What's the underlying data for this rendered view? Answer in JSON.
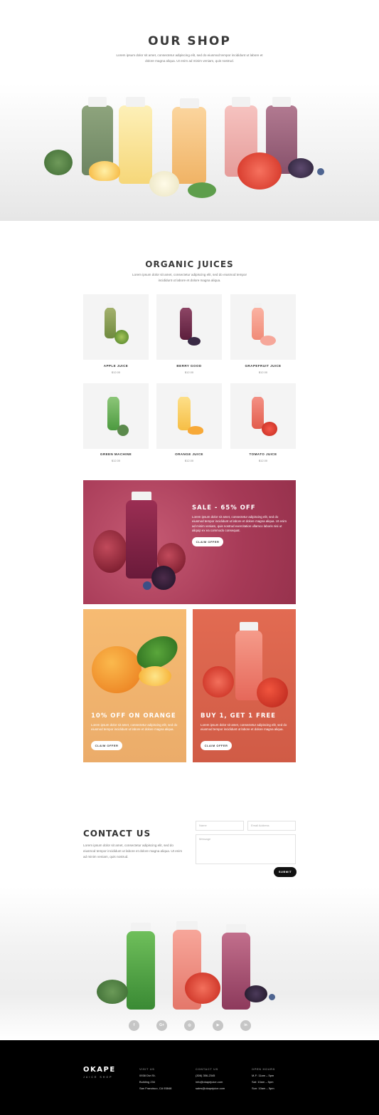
{
  "hero": {
    "title": "OUR SHOP",
    "text": "Lorem ipsum dolor sit amet, consectetur adipiscing elit, sed do eiusmod tempor incididunt ut labore et dolore magna aliqua. Ut enim ad minim veniam, quis nostrud."
  },
  "organic": {
    "title": "ORGANIC JUICES",
    "text": "Lorem ipsum dolor sit amet, consectetur adipiscing elit, sed do eiusmod tempor incididunt ut labore et dolore magna aliqua.",
    "products": [
      {
        "name": "APPLE JUICE",
        "price": "$12.00"
      },
      {
        "name": "BERRY GOOD",
        "price": "$12.00"
      },
      {
        "name": "GRAPEFRUIT JUICE",
        "price": "$12.00"
      },
      {
        "name": "GREEN MACHINE",
        "price": "$12.00"
      },
      {
        "name": "ORANGE JUICE",
        "price": "$12.00"
      },
      {
        "name": "TOMATO JUICE",
        "price": "$12.00"
      }
    ]
  },
  "promos": {
    "sale": {
      "title": "SALE - 65% OFF",
      "text": "Lorem ipsum dolor sit amet, consectetur adipiscing elit, sed do eiusmod tempor incididunt ut labore et dolore magna aliqua. Ut enim ad minim veniam, quis nostrud exercitation ullamco laboris nisi ut aliquip ex ea commodo consequat.",
      "button": "CLAIM OFFER"
    },
    "orange": {
      "title": "10% OFF ON ORANGE",
      "text": "Lorem ipsum dolor sit amet, consectetur adipiscing elit, sed do eiusmod tempor incididunt ut labore et dolore magna aliqua.",
      "button": "CLAIM OFFER"
    },
    "bogo": {
      "title": "BUY 1, GET 1 FREE",
      "text": "Lorem ipsum dolor sit amet, consectetur adipiscing elit, sed do eiusmod tempor incididunt ut labore et dolore magna aliqua.",
      "button": "CLAIM OFFER"
    }
  },
  "contact": {
    "title": "CONTACT US",
    "text": "Lorem ipsum dolor sit amet, consectetur adipiscing elit, sed do eiusmod tempor incididunt ut labore et dolore magna aliqua. Ut enim ad minim veniam, quis nostrud.",
    "name_placeholder": "Name",
    "email_placeholder": "Email Address",
    "message_placeholder": "Message",
    "submit": "SUBMIT"
  },
  "social": [
    "f",
    "G+",
    "◎",
    "▶",
    "in"
  ],
  "footer": {
    "brand": "OKAPE",
    "brand_sub": "JUICE SHOP",
    "visit": {
      "heading": "VISIT US",
      "lines": [
        "0938 Divi St.",
        "Building 234",
        "San Francisco, CA 93848"
      ]
    },
    "contact": {
      "heading": "CONTACT US",
      "lines": [
        "(306) 356-2345",
        "info@okapejuice.com",
        "sales@okapejuice.com"
      ]
    },
    "hours": {
      "heading": "OPEN HOURS",
      "lines": [
        "M-F: 11am – 5pm",
        "Sat: 10am – 5pm",
        "Sun: 10am – 5pm"
      ]
    }
  },
  "colors": {
    "sale_bg": "#a73a57",
    "orange_bg": "#f1b06d",
    "red_bg": "#da6149",
    "footer_bg": "#000000"
  }
}
